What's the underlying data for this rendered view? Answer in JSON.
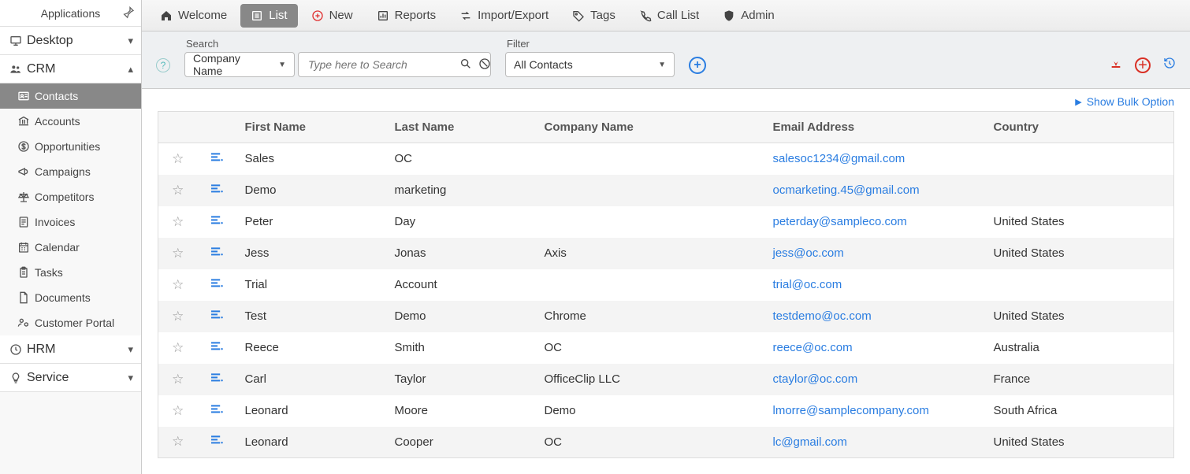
{
  "sidebar": {
    "header": "Applications",
    "modules": [
      {
        "id": "desktop",
        "label": "Desktop",
        "expanded": false
      },
      {
        "id": "crm",
        "label": "CRM",
        "expanded": true,
        "items": [
          {
            "id": "contacts",
            "label": "Contacts",
            "active": true
          },
          {
            "id": "accounts",
            "label": "Accounts"
          },
          {
            "id": "opportunities",
            "label": "Opportunities"
          },
          {
            "id": "campaigns",
            "label": "Campaigns"
          },
          {
            "id": "competitors",
            "label": "Competitors"
          },
          {
            "id": "invoices",
            "label": "Invoices"
          },
          {
            "id": "calendar",
            "label": "Calendar"
          },
          {
            "id": "tasks",
            "label": "Tasks"
          },
          {
            "id": "documents",
            "label": "Documents"
          },
          {
            "id": "customerportal",
            "label": "Customer Portal"
          }
        ]
      },
      {
        "id": "hrm",
        "label": "HRM",
        "expanded": false
      },
      {
        "id": "service",
        "label": "Service",
        "expanded": false
      }
    ]
  },
  "tabs": [
    {
      "id": "welcome",
      "label": "Welcome"
    },
    {
      "id": "list",
      "label": "List",
      "active": true
    },
    {
      "id": "new",
      "label": "New"
    },
    {
      "id": "reports",
      "label": "Reports"
    },
    {
      "id": "importexport",
      "label": "Import/Export"
    },
    {
      "id": "tags",
      "label": "Tags"
    },
    {
      "id": "calllist",
      "label": "Call List"
    },
    {
      "id": "admin",
      "label": "Admin"
    }
  ],
  "toolbar": {
    "search_label": "Search",
    "search_field": "Company Name",
    "search_placeholder": "Type here to Search",
    "search_value": "",
    "filter_label": "Filter",
    "filter_value": "All Contacts"
  },
  "bulk_link": "Show Bulk Option",
  "columns": {
    "first_name": "First Name",
    "last_name": "Last Name",
    "company": "Company Name",
    "email": "Email Address",
    "country": "Country"
  },
  "rows": [
    {
      "first": "Sales",
      "last": "OC",
      "company": "",
      "email": "salesoc1234@gmail.com",
      "country": ""
    },
    {
      "first": "Demo",
      "last": "marketing",
      "company": "",
      "email": "ocmarketing.45@gmail.com",
      "country": ""
    },
    {
      "first": "Peter",
      "last": "Day",
      "company": "",
      "email": "peterday@sampleco.com",
      "country": "United States"
    },
    {
      "first": "Jess",
      "last": "Jonas",
      "company": "Axis",
      "email": "jess@oc.com",
      "country": "United States"
    },
    {
      "first": "Trial",
      "last": "Account",
      "company": "",
      "email": "trial@oc.com",
      "country": ""
    },
    {
      "first": "Test",
      "last": "Demo",
      "company": "Chrome",
      "email": "testdemo@oc.com",
      "country": "United States"
    },
    {
      "first": "Reece",
      "last": "Smith",
      "company": "OC",
      "email": "reece@oc.com",
      "country": "Australia"
    },
    {
      "first": "Carl",
      "last": "Taylor",
      "company": "OfficeClip LLC",
      "email": "ctaylor@oc.com",
      "country": "France"
    },
    {
      "first": "Leonard",
      "last": "Moore",
      "company": "Demo",
      "email": "lmorre@samplecompany.com",
      "country": "South Africa"
    },
    {
      "first": "Leonard",
      "last": "Cooper",
      "company": "OC",
      "email": "lc@gmail.com",
      "country": "United States"
    }
  ]
}
